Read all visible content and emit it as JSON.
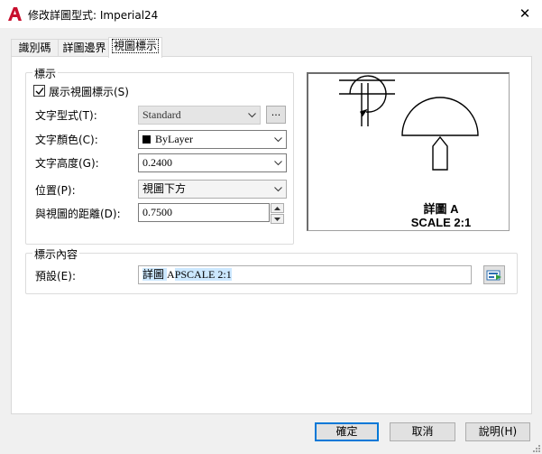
{
  "window": {
    "title": "修改詳圖型式: Imperial24",
    "close": "✕"
  },
  "tabs": [
    {
      "label": "識別碼"
    },
    {
      "label": "詳圖邊界"
    },
    {
      "label": "視圖標示"
    }
  ],
  "label_group": {
    "title": "標示",
    "show_label": {
      "label": "展示視圖標示(S)",
      "checked": true
    },
    "text_style": {
      "label": "文字型式(T):",
      "value": "Standard",
      "browse": "..."
    },
    "text_color": {
      "label": "文字顏色(C):",
      "value": "ByLayer"
    },
    "text_height": {
      "label": "文字高度(G):",
      "value": "0.2400"
    },
    "position": {
      "label": "位置(P):",
      "value": "視圖下方"
    },
    "distance": {
      "label": "與視圖的距離(D):",
      "value": "0.7500"
    }
  },
  "preview": {
    "line1": "詳圖 A",
    "line2": "SCALE 2:1"
  },
  "content_group": {
    "title": "標示內容",
    "default_label": "預設(E):",
    "default_parts": [
      "詳圖 ",
      "A",
      "PSCALE ",
      "2:1"
    ]
  },
  "buttons": {
    "ok": "確定",
    "cancel": "取消",
    "help": "說明(H)"
  },
  "colors": {
    "accent": "#0078d7",
    "app_icon": "#c8102e"
  }
}
